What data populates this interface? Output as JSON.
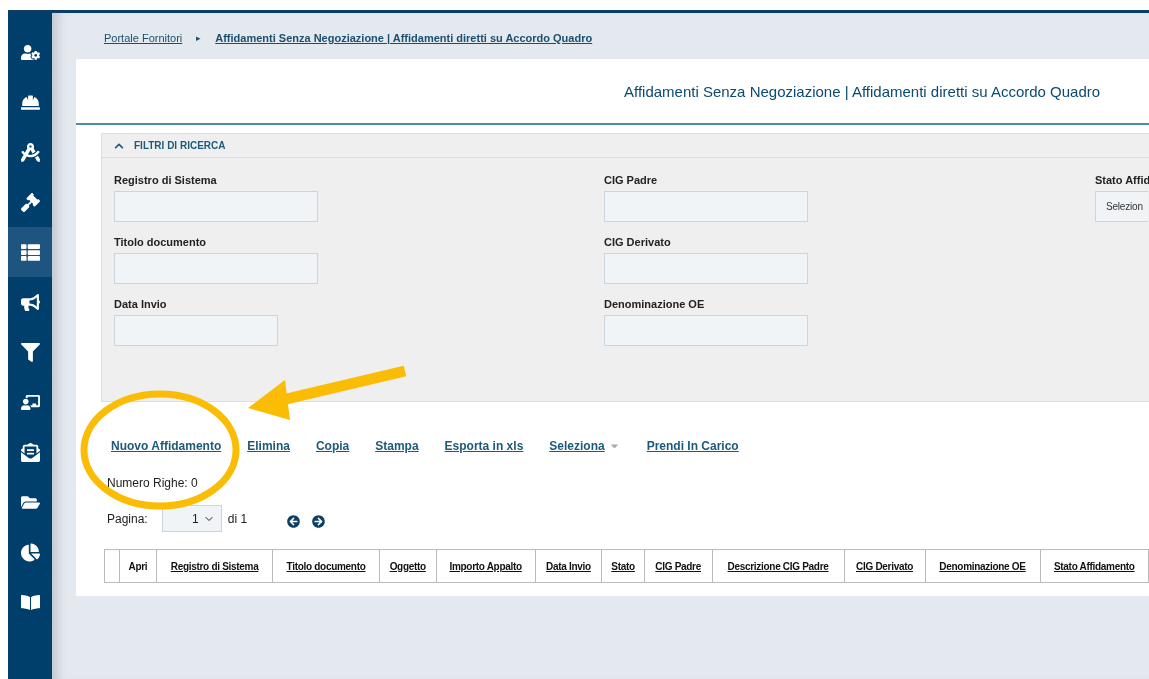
{
  "sidebar": {
    "items": [
      {
        "kind": "user-gear",
        "selected": false
      },
      {
        "kind": "helmet",
        "selected": false
      },
      {
        "kind": "compass",
        "selected": false
      },
      {
        "kind": "gavel",
        "selected": false
      },
      {
        "kind": "list",
        "selected": true
      },
      {
        "kind": "megaphone",
        "selected": false
      },
      {
        "kind": "filter-dollar",
        "selected": false
      },
      {
        "kind": "presentation",
        "selected": false
      },
      {
        "kind": "envelope",
        "selected": false
      },
      {
        "kind": "folder",
        "selected": false
      },
      {
        "kind": "pie",
        "selected": false
      },
      {
        "kind": "book",
        "selected": false
      }
    ]
  },
  "breadcrumb_separator": "▸",
  "breadcrumb": [
    "Portale Fornitori",
    "Affidamenti Senza Negoziazione | Affidamenti diretti su Accordo Quadro"
  ],
  "page_title": "Affidamenti Senza Negoziazione | Affidamenti diretti su Accordo Quadro",
  "filters": {
    "title": "FILTRI DI RICERCA",
    "expanded": true,
    "columns": [
      [
        {
          "label": "Registro di Sistema",
          "kind": "text"
        },
        {
          "label": "Titolo documento",
          "kind": "text"
        },
        {
          "label": "Data Invio",
          "kind": "date"
        }
      ],
      [
        {
          "label": "CIG Padre",
          "kind": "text"
        },
        {
          "label": "CIG Derivato",
          "kind": "text"
        },
        {
          "label": "Denominazione OE",
          "kind": "text"
        }
      ],
      [
        {
          "label": "Stato Affid",
          "kind": "select",
          "value": "Selezion"
        }
      ]
    ]
  },
  "actions": [
    {
      "label": "Nuovo Affidamento",
      "kind": "link"
    },
    {
      "label": "Elimina",
      "kind": "link"
    },
    {
      "label": "Copia",
      "kind": "link"
    },
    {
      "label": "Stampa",
      "kind": "link"
    },
    {
      "label": "Esporta in xls",
      "kind": "link"
    },
    {
      "label": "Seleziona",
      "kind": "dropdown"
    },
    {
      "label": "Prendi In Carico",
      "kind": "link"
    }
  ],
  "row_count": "Numero Righe: 0",
  "pagination": {
    "label": "Pagina:",
    "page": "1",
    "total": "di 1"
  },
  "table": {
    "columns": [
      {
        "kind": "check"
      },
      {
        "label": "Apri",
        "kind": "plain"
      },
      {
        "label": "Registro di Sistema",
        "kind": "sort"
      },
      {
        "label": "Titolo documento",
        "kind": "sort"
      },
      {
        "label": "Oggetto",
        "kind": "sort"
      },
      {
        "label": "Importo Appalto",
        "kind": "sort"
      },
      {
        "label": "Data Invio",
        "kind": "sort"
      },
      {
        "label": "Stato",
        "kind": "sort"
      },
      {
        "label": "CIG Padre",
        "kind": "sort"
      },
      {
        "label": "Descrizione CIG Padre",
        "kind": "sort"
      },
      {
        "label": "CIG Derivato",
        "kind": "sort"
      },
      {
        "label": "Denominazione OE",
        "kind": "sort"
      },
      {
        "label": "Stato Affidamento",
        "kind": "sort"
      }
    ]
  },
  "annotation": {
    "shown": true
  }
}
